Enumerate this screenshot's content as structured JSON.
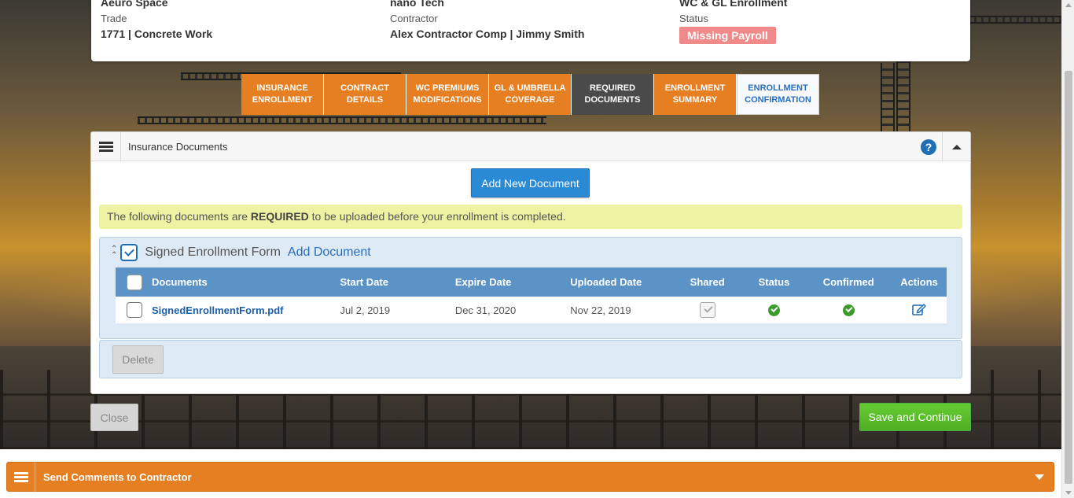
{
  "info": {
    "col1": {
      "top": "Aeuro Space",
      "label": "Trade",
      "value": "1771 | Concrete Work"
    },
    "col2": {
      "top": "nano Tech",
      "label": "Contractor",
      "value": "Alex Contractor Comp | Jimmy Smith"
    },
    "col3": {
      "top": "WC & GL Enrollment",
      "label": "Status",
      "badge": "Missing Payroll"
    }
  },
  "steps": [
    {
      "label": "INSURANCE\nENROLLMENT",
      "state": "done"
    },
    {
      "label": "CONTRACT\nDETAILS",
      "state": "done"
    },
    {
      "label": "WC PREMIUMS\nMODIFICATIONS",
      "state": "done"
    },
    {
      "label": "GL & UMBRELLA\nCOVERAGE",
      "state": "done"
    },
    {
      "label": "REQUIRED\nDOCUMENTS",
      "state": "active"
    },
    {
      "label": "ENROLLMENT\nSUMMARY",
      "state": "done"
    },
    {
      "label": "ENROLLMENT\nCONFIRMATION",
      "state": "next"
    }
  ],
  "panel": {
    "title": "Insurance Documents",
    "help": "?",
    "add_button": "Add New Document",
    "notice_prefix": "The following documents are ",
    "notice_bold": "REQUIRED",
    "notice_suffix": " to be uploaded before your enrollment is completed.",
    "group": {
      "name": "Signed Enrollment Form",
      "add_link": "Add Document",
      "columns": [
        "Documents",
        "Start Date",
        "Expire Date",
        "Uploaded Date",
        "Shared",
        "Status",
        "Confirmed",
        "Actions"
      ],
      "rows": [
        {
          "document": "SignedEnrollmentForm.pdf",
          "start": "Jul 2, 2019",
          "expire": "Dec 31, 2020",
          "uploaded": "Nov 22, 2019"
        }
      ]
    },
    "delete_button": "Delete"
  },
  "footer": {
    "close": "Close",
    "save": "Save and Continue"
  },
  "comments": {
    "title": "Send Comments to Contractor"
  },
  "colors": {
    "step_orange": "#e67e22",
    "step_active": "#4a4a4a",
    "primary_blue": "#2a8ad4",
    "save_green": "#5cb85c",
    "badge_pink": "#f0898a"
  }
}
